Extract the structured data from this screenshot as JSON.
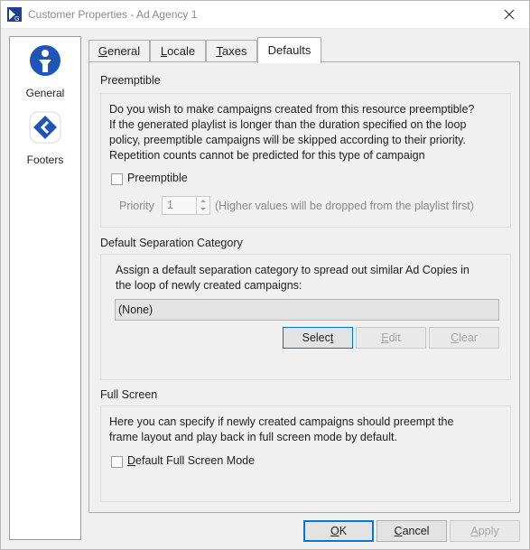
{
  "window": {
    "title": "Customer Properties - Ad Agency 1",
    "colors": {
      "accent": "#0078d7",
      "icon_blue": "#1f55b8"
    }
  },
  "sidebar": {
    "items": [
      {
        "label": "General",
        "icon": "info-person-icon"
      },
      {
        "label": "Footers",
        "icon": "diamond-chevron-icon"
      }
    ]
  },
  "tabs": [
    {
      "label": "General",
      "accel": "G",
      "rest": "eneral"
    },
    {
      "label": "Locale",
      "accel": "L",
      "rest": "ocale"
    },
    {
      "label": "Taxes",
      "accel": "T",
      "rest": "axes"
    },
    {
      "label": "Defaults",
      "active": true
    }
  ],
  "preemptible": {
    "section_title": "Preemptible",
    "description_lines": [
      "Do you wish to make campaigns created from this resource preemptible?",
      "If the generated playlist is longer than the duration specified on the loop",
      "policy, preemptible campaigns will be skipped according to their priority.",
      "Repetition counts cannot be predicted for this type of campaign"
    ],
    "checkbox_label": "Preemptible",
    "checked": false,
    "priority_label": "Priority",
    "priority_value": "1",
    "priority_hint": "(Higher values will be dropped from the playlist first)"
  },
  "separation": {
    "section_title": "Default Separation Category",
    "description_lines": [
      "Assign a default separation category to spread out similar Ad Copies in",
      "the loop of newly created campaigns:"
    ],
    "value": "(None)",
    "buttons": {
      "select_pre": "Selec",
      "select_accel": "t",
      "edit_accel": "E",
      "edit_rest": "dit",
      "clear_accel": "C",
      "clear_rest": "lear"
    }
  },
  "fullscreen": {
    "section_title": "Full Screen",
    "description_lines": [
      "Here you can specify if newly created campaigns should preempt the",
      "frame layout and play back in full screen mode by default."
    ],
    "checkbox_accel": "D",
    "checkbox_rest": "efault Full Screen Mode",
    "checked": false
  },
  "footer": {
    "ok_accel": "O",
    "ok_rest": "K",
    "cancel_accel": "C",
    "cancel_rest": "ancel",
    "apply_accel": "A",
    "apply_rest": "pply"
  }
}
